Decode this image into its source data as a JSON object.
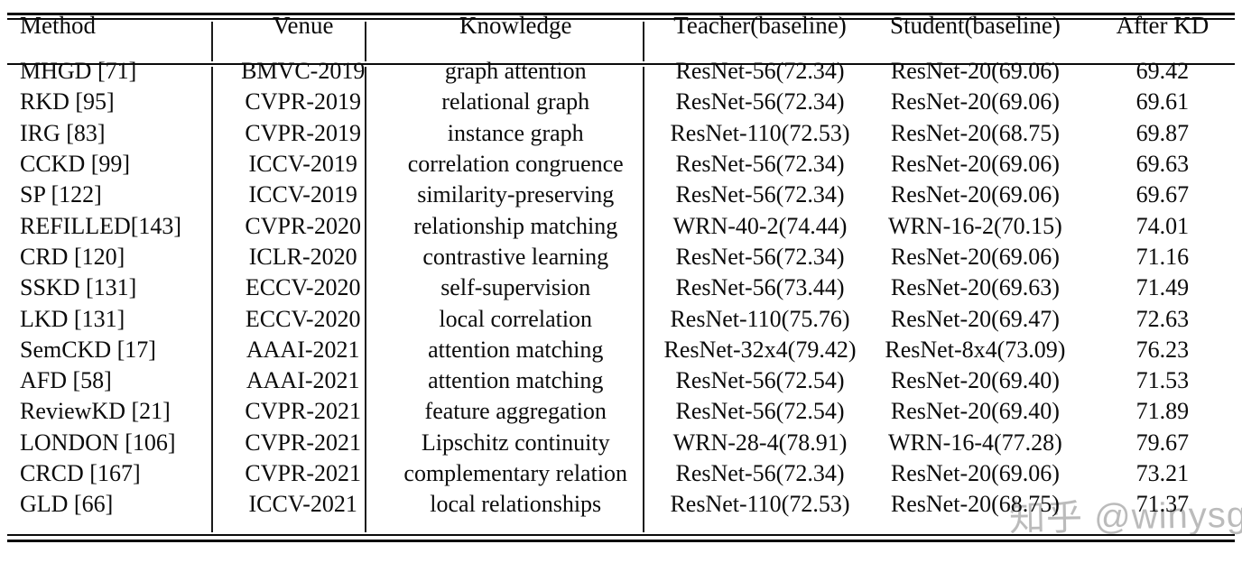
{
  "table": {
    "columns": [
      "Method",
      "Venue",
      "Knowledge",
      "Teacher(baseline)",
      "Student(baseline)",
      "After KD"
    ],
    "rows": [
      {
        "method": "MHGD [71]",
        "venue": "BMVC-2019",
        "knowledge": "graph attention",
        "teacher": "ResNet-56(72.34)",
        "student": "ResNet-20(69.06)",
        "after_kd": "69.42"
      },
      {
        "method": "RKD [95]",
        "venue": "CVPR-2019",
        "knowledge": "relational graph",
        "teacher": "ResNet-56(72.34)",
        "student": "ResNet-20(69.06)",
        "after_kd": "69.61"
      },
      {
        "method": "IRG [83]",
        "venue": "CVPR-2019",
        "knowledge": "instance graph",
        "teacher": "ResNet-110(72.53)",
        "student": "ResNet-20(68.75)",
        "after_kd": "69.87"
      },
      {
        "method": "CCKD [99]",
        "venue": "ICCV-2019",
        "knowledge": "correlation congruence",
        "teacher": "ResNet-56(72.34)",
        "student": "ResNet-20(69.06)",
        "after_kd": "69.63"
      },
      {
        "method": "SP [122]",
        "venue": "ICCV-2019",
        "knowledge": "similarity-preserving",
        "teacher": "ResNet-56(72.34)",
        "student": "ResNet-20(69.06)",
        "after_kd": "69.67"
      },
      {
        "method": "REFILLED[143]",
        "venue": "CVPR-2020",
        "knowledge": "relationship matching",
        "teacher": "WRN-40-2(74.44)",
        "student": "WRN-16-2(70.15)",
        "after_kd": "74.01"
      },
      {
        "method": "CRD [120]",
        "venue": "ICLR-2020",
        "knowledge": "contrastive learning",
        "teacher": "ResNet-56(72.34)",
        "student": "ResNet-20(69.06)",
        "after_kd": "71.16"
      },
      {
        "method": "SSKD [131]",
        "venue": "ECCV-2020",
        "knowledge": "self-supervision",
        "teacher": "ResNet-56(73.44)",
        "student": "ResNet-20(69.63)",
        "after_kd": "71.49"
      },
      {
        "method": "LKD [131]",
        "venue": "ECCV-2020",
        "knowledge": "local correlation",
        "teacher": "ResNet-110(75.76)",
        "student": "ResNet-20(69.47)",
        "after_kd": "72.63"
      },
      {
        "method": "SemCKD [17]",
        "venue": "AAAI-2021",
        "knowledge": "attention matching",
        "teacher": "ResNet-32x4(79.42)",
        "student": "ResNet-8x4(73.09)",
        "after_kd": "76.23"
      },
      {
        "method": "AFD [58]",
        "venue": "AAAI-2021",
        "knowledge": "attention matching",
        "teacher": "ResNet-56(72.54)",
        "student": "ResNet-20(69.40)",
        "after_kd": "71.53"
      },
      {
        "method": "ReviewKD [21]",
        "venue": "CVPR-2021",
        "knowledge": "feature aggregation",
        "teacher": "ResNet-56(72.54)",
        "student": "ResNet-20(69.40)",
        "after_kd": "71.89"
      },
      {
        "method": "LONDON [106]",
        "venue": "CVPR-2021",
        "knowledge": "Lipschitz continuity",
        "teacher": "WRN-28-4(78.91)",
        "student": "WRN-16-4(77.28)",
        "after_kd": "79.67"
      },
      {
        "method": "CRCD [167]",
        "venue": "CVPR-2021",
        "knowledge": "complementary relation",
        "teacher": "ResNet-56(72.34)",
        "student": "ResNet-20(69.06)",
        "after_kd": "73.21"
      },
      {
        "method": "GLD [66]",
        "venue": "ICCV-2021",
        "knowledge": "local relationships",
        "teacher": "ResNet-110(72.53)",
        "student": "ResNet-20(68.75)",
        "after_kd": "71.37"
      }
    ]
  },
  "watermark": {
    "text": "知乎 @winysg"
  }
}
